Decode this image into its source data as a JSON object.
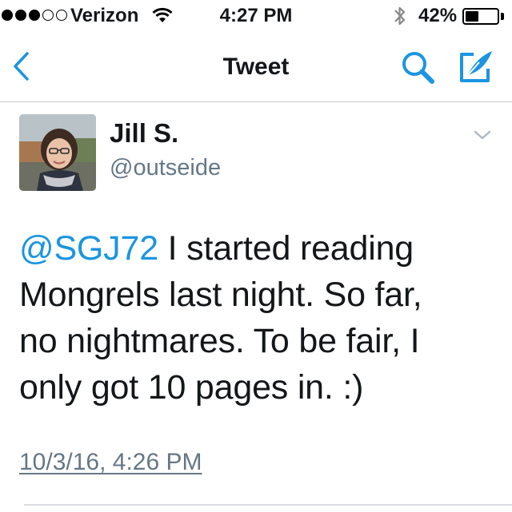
{
  "status_bar": {
    "carrier": "Verizon",
    "time": "4:27 PM",
    "battery_percent": "42%",
    "battery_level": 0.42,
    "signal_bars_filled": 3,
    "signal_bars_total": 5,
    "icons": [
      "wifi-icon",
      "bluetooth-icon",
      "battery-icon"
    ]
  },
  "nav": {
    "title": "Tweet",
    "left_icon": "back-chevron-icon",
    "right_icons": [
      "search-icon",
      "compose-tweet-icon"
    ],
    "accent_color": "#1b95e0"
  },
  "tweet": {
    "author": {
      "display_name": "Jill S.",
      "handle": "@outseide",
      "avatar": "profile-photo"
    },
    "mention": "@SGJ72",
    "text_lines": [
      " I started reading",
      "Mongrels last night. So far,",
      "no nightmares. To be fair, I",
      "only got 10 pages in. :)"
    ],
    "timestamp": "10/3/16, 4:26 PM",
    "menu_icon": "chevron-down-icon"
  },
  "colors": {
    "link": "#1b95e0",
    "secondary_text": "#657786",
    "primary_text": "#14171a"
  }
}
